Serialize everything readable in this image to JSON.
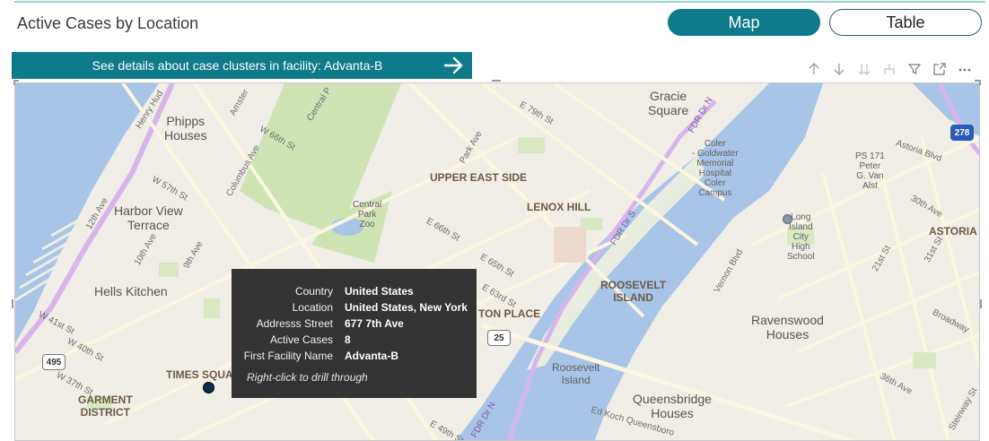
{
  "header": {
    "title": "Active Cases by Location",
    "toggle_map": "Map",
    "toggle_table": "Table"
  },
  "drill": {
    "label": "See details about case clusters in facility: Advanta-B"
  },
  "toolbar": {
    "icons": [
      "arrow-up-icon",
      "arrow-down-icon",
      "double-arrow-down-icon",
      "expand-hierarchy-icon",
      "filter-icon",
      "focus-mode-icon",
      "more-options-icon"
    ]
  },
  "map": {
    "labels": {
      "gracie_square": "Gracie\nSquare",
      "phipps_houses": "Phipps\nHouses",
      "harbor_view": "Harbor View\nTerrace",
      "hells_kitchen": "Hells Kitchen",
      "upper_east_side": "UPPER EAST SIDE",
      "lenox_hill": "LENOX HILL",
      "central_park_zoo": "Central\nPark\nZoo",
      "coler": "Coler\n- Goldwater\nMemorial\nHospital\nColer\nCampus",
      "ps171": "PS 171\nPeter\nG. Van\nAlst",
      "astoria": "ASTORIA",
      "long_island_city": "Long\nIsland\nCity\nHigh\nSchool",
      "roosevelt_island_caps": "ROOSEVELT\nISLAND",
      "roosevelt_island": "Roosevelt\nIsland",
      "ravenswood": "Ravenswood\nHouses",
      "queensbridge": "Queensbridge\nHouses",
      "times_square": "TIMES SQUARE",
      "garment_district": "GARMENT\nDISTRICT",
      "ton_place": "TON PLACE"
    },
    "streets": {
      "henry_hudson": "Henry Hud",
      "twelfth_ave": "12th Ave",
      "amsterdam": "Amster",
      "central_park_w": "Central P",
      "w66": "W 66th St",
      "w57": "W 57th St",
      "columbus": "Columbus Ave",
      "tenth_ave": "10th Ave",
      "ninth_ave": "9th Ave",
      "w41": "W 41st St",
      "w40": "W 40th St",
      "w37": "W 37th St",
      "e79": "E 79th St",
      "park_ave": "Park Ave",
      "e66": "E 66th St",
      "e65": "E 65th St",
      "e63": "E 63rd St",
      "e60": "E 60th St",
      "e49": "E 49th St",
      "fdr_top": "FDR Dr N",
      "fdr_mid": "FDR Dr S",
      "fdr_low": "FDR Dr N",
      "astoria_blvd": "Astoria Blvd",
      "thirtieth_ave": "30th Ave",
      "twentyfirst": "21st St",
      "thirtyfirst": "31st St",
      "vernon": "Vernon Blvd",
      "broadway": "Broadway",
      "thirtysixth": "36th Ave",
      "steinway": "Steinway St",
      "ed_koch": "Ed Koch Queensboro"
    },
    "shields": {
      "i278": "278",
      "r25": "25",
      "r495": "495"
    },
    "colors": {
      "water": "#a8c5e8",
      "land": "#f0eee6",
      "park": "#cfe3b5",
      "highway": "#d6b6ea",
      "road": "#fbf6e0",
      "marker": "#0c2d48"
    }
  },
  "tooltip": {
    "rows": [
      {
        "key": "Country",
        "value": "United States"
      },
      {
        "key": "Location",
        "value": "United States, New York"
      },
      {
        "key": "Addresss Street",
        "value": "677 7th Ave"
      },
      {
        "key": "Active Cases",
        "value": "8"
      },
      {
        "key": "First Facility Name",
        "value": "Advanta-B"
      }
    ],
    "hint": "Right-click to drill through"
  }
}
